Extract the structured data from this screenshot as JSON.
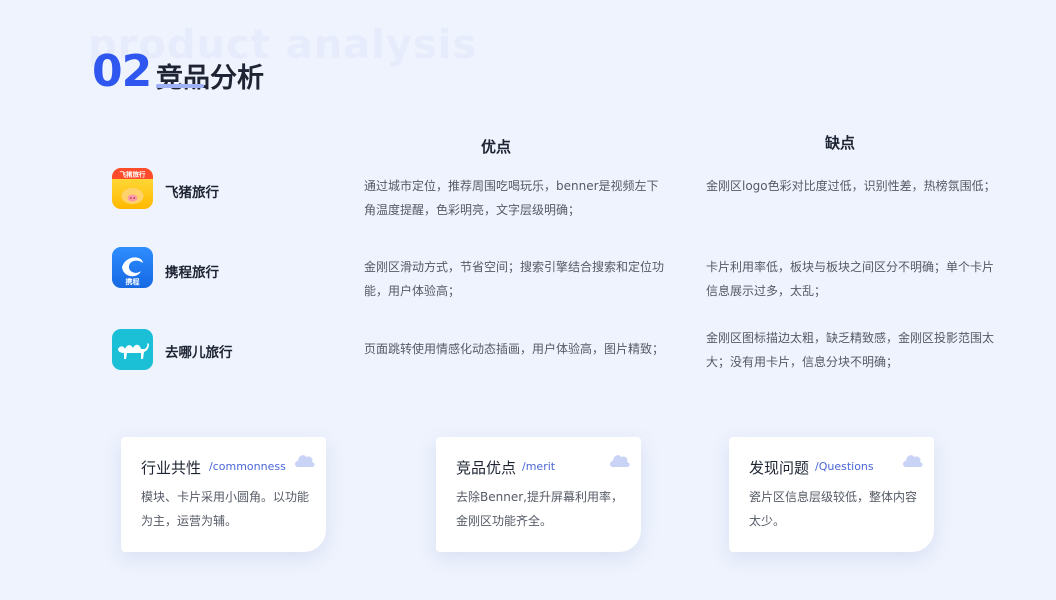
{
  "header": {
    "bg_word": "product analysis",
    "number": "02",
    "title": "竞品分析"
  },
  "columns": {
    "pros": "优点",
    "cons": "缺点"
  },
  "apps": [
    {
      "name": "飞猪旅行",
      "icon": "fliggy-logo-icon",
      "icon_text": "飞猪旅行",
      "pros": "通过城市定位，推荐周围吃喝玩乐，benner是视频左下角温度提醒，色彩明亮，文字层级明确；",
      "cons": "金刚区logo色彩对比度过低，识别性差，热榜氛围低；"
    },
    {
      "name": "携程旅行",
      "icon": "ctrip-logo-icon",
      "icon_text": "携程",
      "pros": "金刚区滑动方式，节省空间；搜索引擎结合搜索和定位功能，用户体验高；",
      "cons": "卡片利用率低，板块与板块之间区分不明确；单个卡片信息展示过多，太乱；"
    },
    {
      "name": "去哪儿旅行",
      "icon": "qunar-logo-icon",
      "pros": "页面跳转使用情感化动态插画，用户体验高，图片精致；",
      "cons": "金刚区图标描边太粗，缺乏精致感，金刚区投影范围太大；没有用卡片，信息分块不明确；"
    }
  ],
  "cards": [
    {
      "title": "行业共性",
      "subtitle": "/commonness",
      "text": "模块、卡片采用小圆角。以功能为主，运营为辅。"
    },
    {
      "title": "竞品优点",
      "subtitle": "/merit",
      "text": "去除Benner,提升屏幕利用率，金刚区功能齐全。"
    },
    {
      "title": "发现问题",
      "subtitle": "/Questions",
      "text": "瓷片区信息层级较低，整体内容太少。"
    }
  ],
  "colors": {
    "accent": "#2f57f0",
    "background": "#eef3fd",
    "card_icon": "#c9d3f5"
  }
}
